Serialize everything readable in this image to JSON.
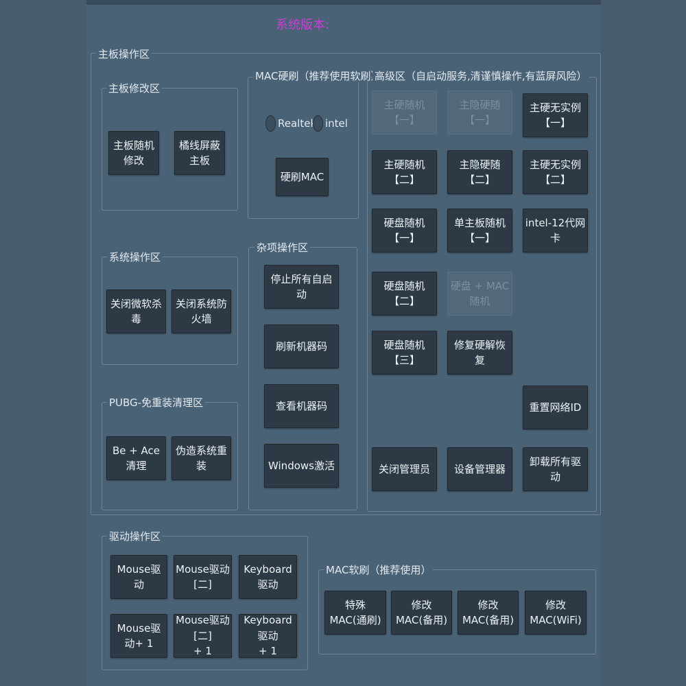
{
  "header": {
    "version_label": "系统版本:"
  },
  "groups": {
    "mainboard_ops": {
      "title": "主板操作区"
    },
    "mainboard_mod": {
      "title": "主板修改区",
      "buttons": [
        "主板随机修改",
        "橘线屏蔽主板"
      ]
    },
    "mac_hard": {
      "title": "MAC硬刷（推荐使用软刷）",
      "radios": [
        "Realtek",
        "intel"
      ],
      "button": "硬刷MAC"
    },
    "advanced": {
      "title": "高级区（自启动服务,清谨慎操作,有蓝屏风险）",
      "buttons": [
        "主硬随机【一】",
        "主隐硬随【一】",
        "主硬无实例【一】",
        "主硬随机【二】",
        "主隐硬随【二】",
        "主硬无实例【二】",
        "硬盘随机【一】",
        "单主板随机【一】",
        "intel-12代网卡",
        "硬盘随机【二】",
        "硬盘 + MAC随机",
        "硬盘随机【三】",
        "修复硬解恢复",
        "重置网络ID",
        "关闭管理员",
        "设备管理器",
        "卸载所有驱动"
      ]
    },
    "system_ops": {
      "title": "系统操作区",
      "buttons": [
        "关闭微软杀毒",
        "关闭系统防火墙"
      ]
    },
    "misc_ops": {
      "title": "杂项操作区",
      "buttons": [
        "停止所有自启动",
        "刷新机器码",
        "查看机器码",
        "Windows激活"
      ]
    },
    "pubg": {
      "title": "PUBG-免重装清理区",
      "buttons": [
        "Be + Ace清理",
        "伪造系统重装"
      ]
    },
    "driver_ops": {
      "title": "驱动操作区",
      "buttons": [
        "Mouse驱动",
        "Mouse驱动[二]",
        "Keyboard驱动",
        "Mouse驱动+ 1",
        "Mouse驱动[二]\n+ 1",
        "Keyboard驱动\n+ 1"
      ]
    },
    "mac_soft": {
      "title": "MAC软刷（推荐使用）",
      "buttons": [
        "特殊MAC(通刷)",
        "修改MAC(备用)",
        "修改MAC(备用)",
        "修改MAC(WiFi)"
      ]
    }
  },
  "colors": {
    "accent_version": "#cc3dd6",
    "button_bg": "#2d3a46",
    "panel_bg": "#4a6275"
  }
}
